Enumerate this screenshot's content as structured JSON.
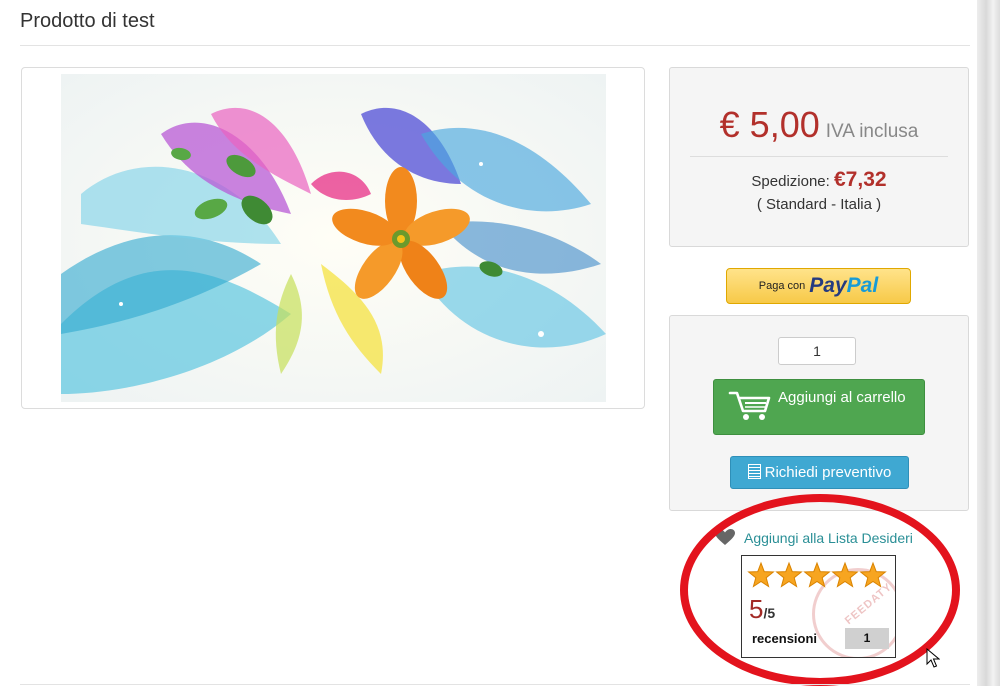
{
  "product": {
    "title": "Prodotto di test"
  },
  "price": {
    "amount": "€ 5,00",
    "vat_label": "IVA inclusa"
  },
  "shipping": {
    "label": "Spedizione:",
    "cost": "€7,32",
    "method": "( Standard - Italia )"
  },
  "paypal": {
    "prefix": "Paga con",
    "brand_pay": "Pay",
    "brand_pal": "Pal"
  },
  "cart": {
    "quantity": "1",
    "add_label": "Aggiungi al carrello",
    "quote_label": "Richiedi preventivo"
  },
  "wishlist": {
    "label": "Aggiungi alla Lista Desideri"
  },
  "rating": {
    "score": "5",
    "max": "/5",
    "reviews_label": "recensioni",
    "reviews_count": "1",
    "stars": 5,
    "stamp_text": "FEEDATY"
  },
  "colors": {
    "price_red": "#b2302b",
    "cart_green": "#4fa650",
    "quote_blue": "#3fa8d2",
    "highlight_red": "#e3131d",
    "link_teal": "#2a8f96"
  },
  "icons": [
    "cart-icon",
    "document-icon",
    "heart-icon",
    "star-icon",
    "mouse-cursor-icon"
  ]
}
